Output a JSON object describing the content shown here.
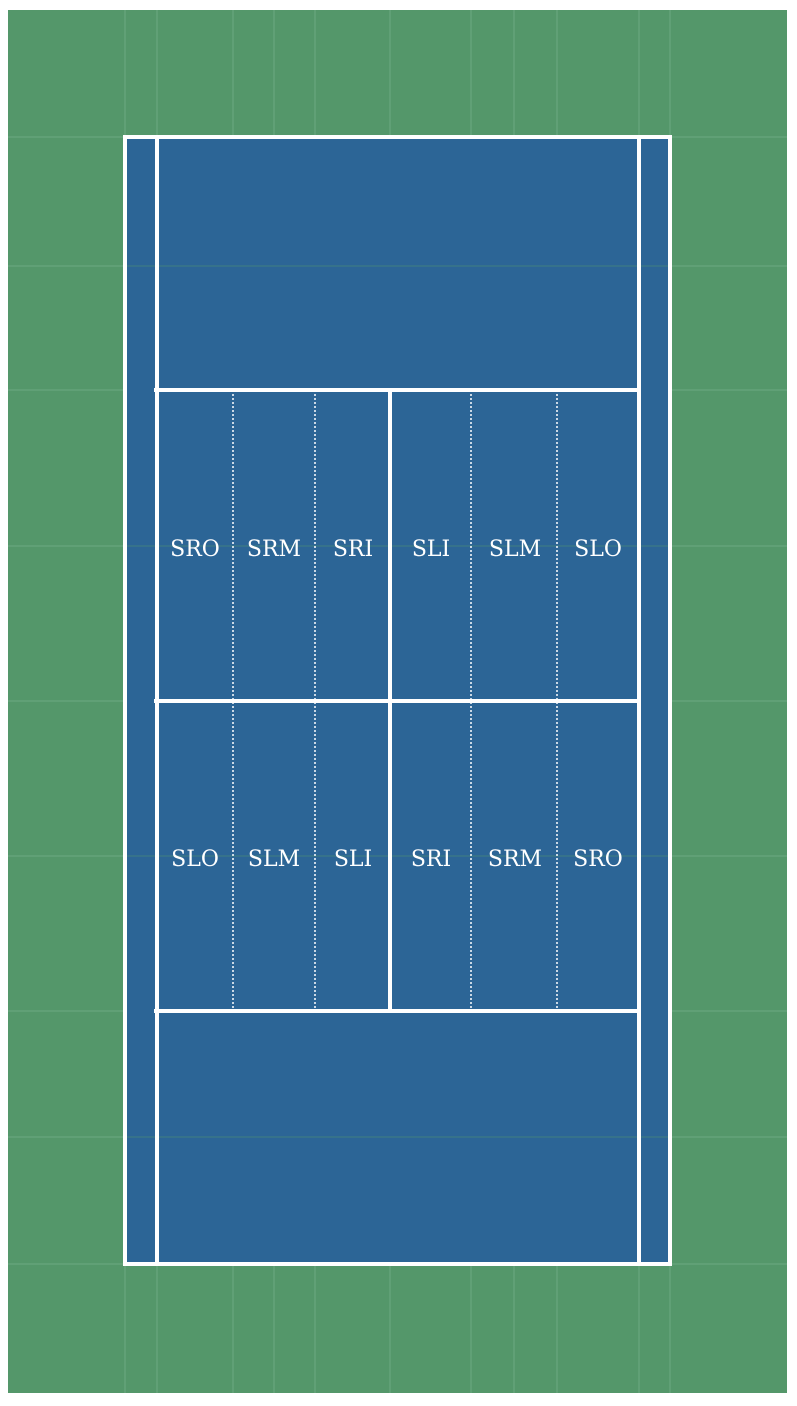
{
  "colors": {
    "surround": "#54976a",
    "court": "#2c6596",
    "lines": "#ffffff",
    "grid": "#7fb592",
    "label": "#ffffff"
  },
  "zones": {
    "upper_service_box": [
      "SRO",
      "SRM",
      "SRI",
      "SLI",
      "SLM",
      "SLO"
    ],
    "lower_service_box": [
      "SLO",
      "SLM",
      "SLI",
      "SRI",
      "SRM",
      "SRO"
    ]
  }
}
